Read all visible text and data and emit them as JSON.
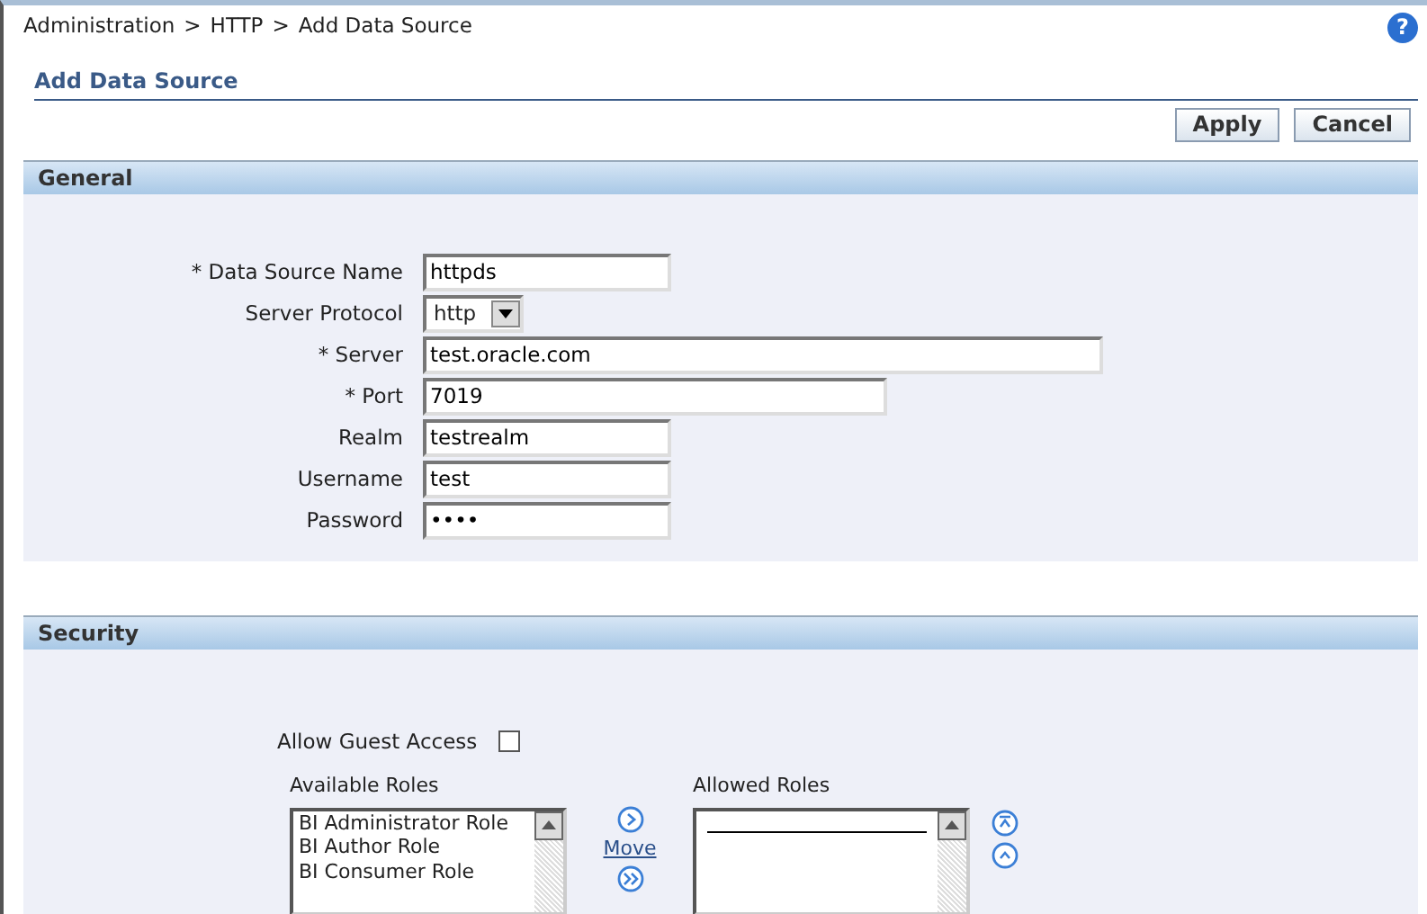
{
  "breadcrumb": [
    {
      "kind": "link",
      "label": "Administration"
    },
    {
      "kind": "separator",
      "label": ">"
    },
    {
      "kind": "link",
      "label": "HTTP"
    },
    {
      "kind": "separator",
      "label": ">"
    },
    {
      "kind": "current",
      "label": "Add Data Source"
    }
  ],
  "help": "?",
  "page_title": "Add Data Source",
  "buttons": [
    "Apply",
    "Cancel"
  ],
  "general": {
    "title": "General",
    "fields": [
      {
        "kind": "text",
        "label": "* Data Source Name",
        "value": "httpds"
      },
      {
        "kind": "select",
        "label": "Server Protocol",
        "value": "http"
      },
      {
        "kind": "text",
        "label": "* Server",
        "value": "test.oracle.com"
      },
      {
        "kind": "text",
        "label": "* Port",
        "value": "7019"
      },
      {
        "kind": "text",
        "label": "Realm",
        "value": "testrealm"
      },
      {
        "kind": "text",
        "label": "Username",
        "value": "test"
      },
      {
        "kind": "text",
        "label": "Password",
        "value": "••••"
      }
    ]
  },
  "security": {
    "title": "Security",
    "guest": {
      "label": "Allow Guest Access",
      "checked": false
    },
    "available": {
      "label": "Available Roles",
      "items": [
        "BI Administrator Role",
        "BI Author Role",
        "BI Consumer Role"
      ]
    },
    "move_link": "Move",
    "allowed": {
      "label": "Allowed Roles"
    }
  }
}
